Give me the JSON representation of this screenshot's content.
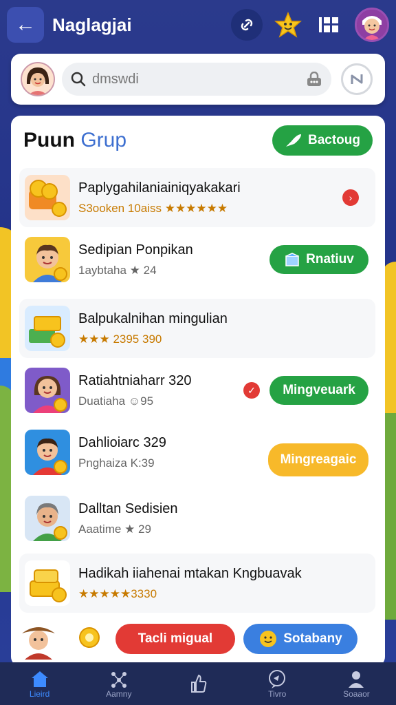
{
  "header": {
    "back_glyph": "←",
    "title": "Naglagjai",
    "icons": [
      "link-icon",
      "star-icon",
      "grid-icon",
      "profile-avatar"
    ]
  },
  "search": {
    "value": "dmswdi",
    "placeholder": "dmswdi"
  },
  "group": {
    "title_prefix": "Puun",
    "title_accent": "Grup",
    "header_button": "Bactoug"
  },
  "rows": [
    {
      "name": "Paplygahilaniainiqyakakari",
      "sub": "S3ooken 10aiss ★★★★★★",
      "action": "",
      "icon": "chevron-right-icon"
    },
    {
      "name": "Sedipian Ponpikan",
      "sub": "1aybtaha ★ 24",
      "action": "Rnatiuv"
    },
    {
      "name": "Balpukalnihan mingulian",
      "sub": "★★★ 2395 390",
      "action": ""
    },
    {
      "name": "Ratiahtniaharr 320",
      "sub": "Duatiaha ☺95",
      "action": "Mingveuark"
    },
    {
      "name": "Dahlioiarc 329",
      "sub": "Pnghaiza K:39",
      "action": "Mingreagaic"
    },
    {
      "name": "Dalltan Sedisien",
      "sub": "Aaatime ★ 29",
      "action": ""
    },
    {
      "name": "Hadikah iiahenai mtakan Kngbuavak",
      "sub": "★★★★★3330",
      "action": ""
    }
  ],
  "actions": {
    "primary": "Tacli migual",
    "secondary": "Sotabany"
  },
  "nav": [
    {
      "label": "Lieird",
      "icon": "home-icon",
      "active": true
    },
    {
      "label": "Aamny",
      "icon": "network-icon",
      "active": false
    },
    {
      "label": "",
      "icon": "thumbs-up-icon",
      "active": false
    },
    {
      "label": "Tivro",
      "icon": "chat-icon",
      "active": false
    },
    {
      "label": "Soaaor",
      "icon": "user-icon",
      "active": false
    }
  ],
  "colors": {
    "background": "#2b3a8c",
    "green": "#25a244",
    "yellow": "#f7b92a",
    "red": "#e23a35",
    "blue": "#3a7fe0",
    "nav_bg": "#1f2b57",
    "accent": "#3d6fd0"
  }
}
